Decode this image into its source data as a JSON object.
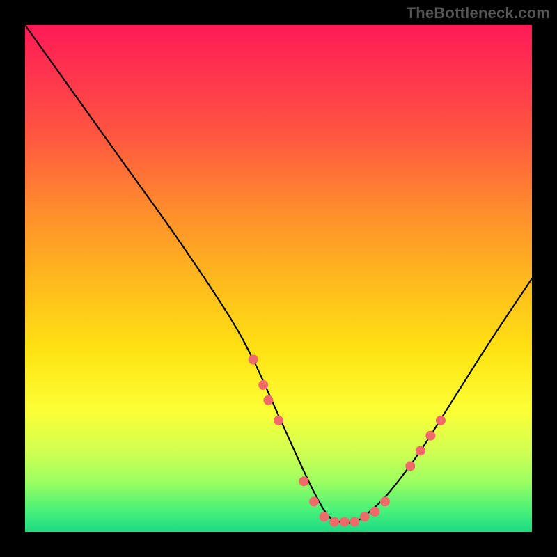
{
  "watermark": "TheBottleneck.com",
  "chart_data": {
    "type": "line",
    "title": "",
    "xlabel": "",
    "ylabel": "",
    "xlim": [
      0,
      100
    ],
    "ylim": [
      0,
      100
    ],
    "series": [
      {
        "name": "curve",
        "x": [
          0,
          10,
          20,
          30,
          40,
          45,
          50,
          55,
          58,
          60,
          62,
          65,
          68,
          72,
          78,
          85,
          92,
          100
        ],
        "y": [
          100,
          86,
          72,
          58,
          43,
          34,
          23,
          12,
          6,
          3,
          2,
          2,
          4,
          8,
          16,
          27,
          38,
          50
        ],
        "stroke": "#000000"
      }
    ],
    "markers": {
      "name": "highlighted-points",
      "color": "#f06a6a",
      "points": [
        {
          "x": 45,
          "y": 34
        },
        {
          "x": 47,
          "y": 29
        },
        {
          "x": 48,
          "y": 26
        },
        {
          "x": 50,
          "y": 22
        },
        {
          "x": 55,
          "y": 10
        },
        {
          "x": 57,
          "y": 6
        },
        {
          "x": 59,
          "y": 3
        },
        {
          "x": 61,
          "y": 2
        },
        {
          "x": 63,
          "y": 2
        },
        {
          "x": 65,
          "y": 2
        },
        {
          "x": 67,
          "y": 3
        },
        {
          "x": 69,
          "y": 4
        },
        {
          "x": 71,
          "y": 6
        },
        {
          "x": 76,
          "y": 13
        },
        {
          "x": 78,
          "y": 16
        },
        {
          "x": 80,
          "y": 19
        },
        {
          "x": 82,
          "y": 22
        }
      ]
    },
    "gradient_stops": [
      {
        "pos": 0,
        "color": "#ff1a56"
      },
      {
        "pos": 50,
        "color": "#ffb81e"
      },
      {
        "pos": 100,
        "color": "#1eda83"
      }
    ]
  }
}
